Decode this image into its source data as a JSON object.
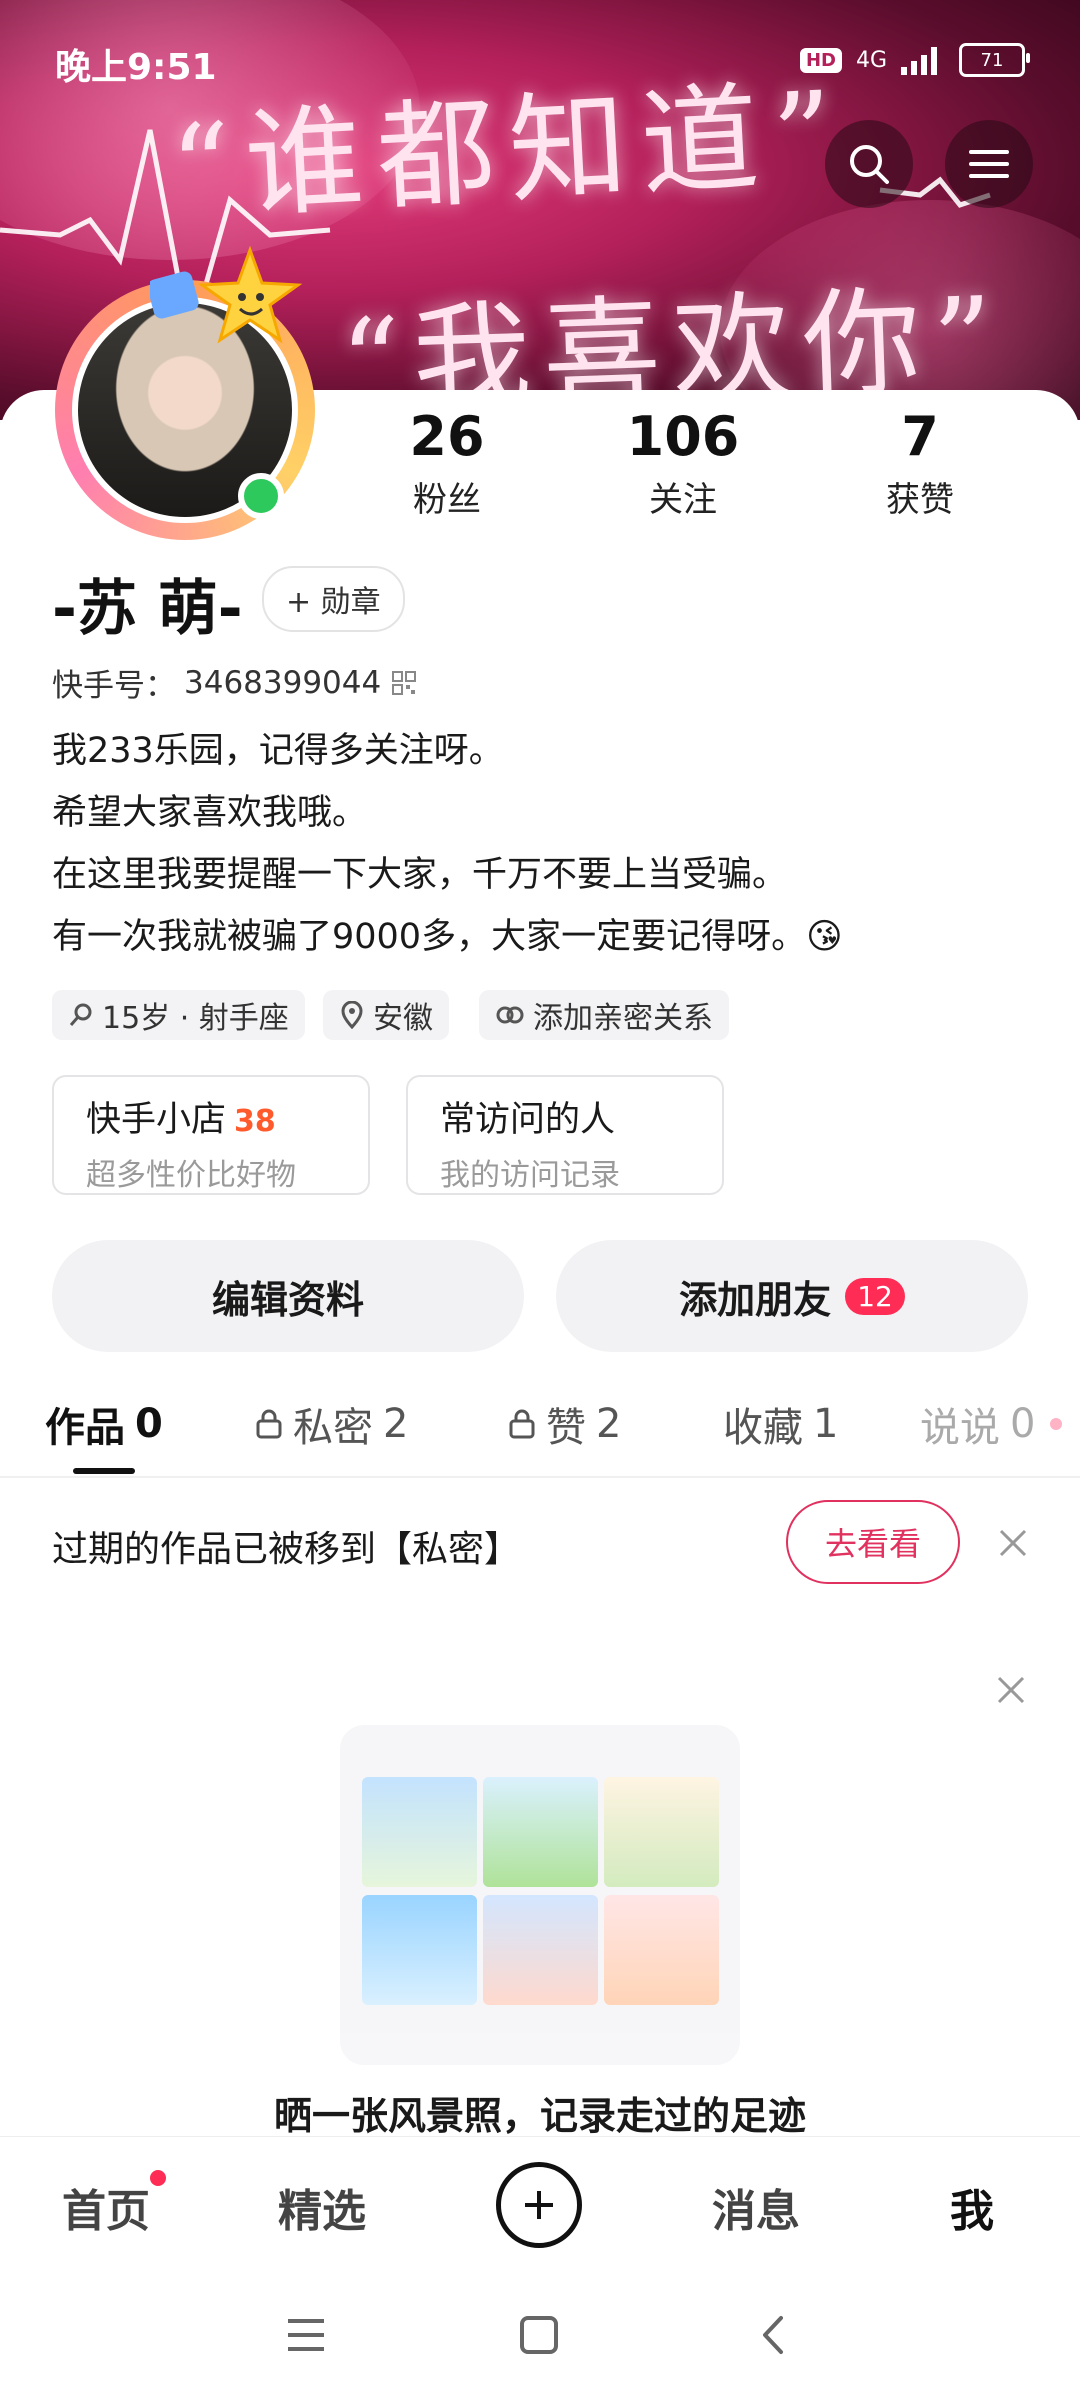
{
  "status": {
    "time": "晚上9:51",
    "hd": "HD",
    "network": "4G",
    "battery": "71"
  },
  "banner": {
    "line1": "“谁都知道”",
    "line2": "“我喜欢你”"
  },
  "stats": [
    {
      "num": "26",
      "label": "粉丝"
    },
    {
      "num": "106",
      "label": "关注"
    },
    {
      "num": "7",
      "label": "获赞"
    }
  ],
  "profile": {
    "username": "-苏 萌-",
    "medal_button": "+ 勋章",
    "id_label": "快手号：",
    "id_value": "3468399044",
    "bio": [
      "我233乐园，记得多关注呀。",
      "希望大家喜欢我哦。",
      "在这里我要提醒一下大家，千万不要上当受骗。",
      "有一次我就被骗了9000多，大家一定要记得呀。😘"
    ],
    "tags": [
      "15岁 · 射手座",
      "安徽",
      "添加亲密关系"
    ]
  },
  "cards": [
    {
      "title": "快手小店",
      "count": "38",
      "subtitle": "超多性价比好物"
    },
    {
      "title": "常访问的人",
      "count": "",
      "subtitle": "我的访问记录"
    }
  ],
  "actions": {
    "edit_profile": "编辑资料",
    "add_friends": "添加朋友",
    "add_friends_badge": "12"
  },
  "tabs": [
    {
      "label": "作品",
      "count": "0"
    },
    {
      "label": "私密",
      "count": "2"
    },
    {
      "label": "赞",
      "count": "2"
    },
    {
      "label": "收藏",
      "count": "1"
    },
    {
      "label": "说说",
      "count": "0"
    }
  ],
  "notice": {
    "text": "过期的作品已被移到【私密】",
    "button": "去看看"
  },
  "empty_state": {
    "caption": "晒一张风景照，记录走过的足迹"
  },
  "bottom_nav": [
    "首页",
    "精选",
    "消息",
    "我"
  ],
  "colors": {
    "accent": "#e0315f",
    "online": "#2ec95c",
    "shop_count": "#ff5a2c",
    "badge": "#ff2d55"
  }
}
